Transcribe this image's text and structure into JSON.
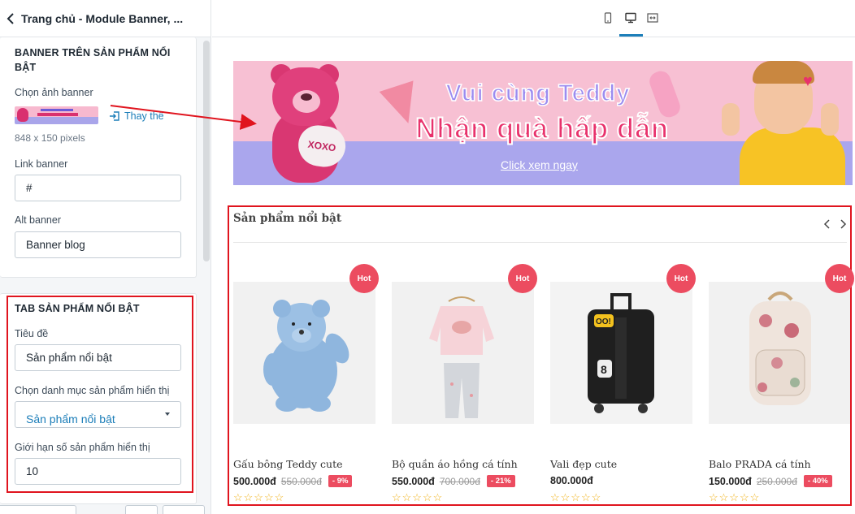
{
  "header": {
    "title": "Trang chủ - Module Banner, ..."
  },
  "banner_section": {
    "title": "BANNER TRÊN SẢN PHẨM NỔI BẬT",
    "image_label": "Chọn ảnh banner",
    "replace_label": "Thay thế",
    "image_size": "848 x 150 pixels",
    "link_label": "Link banner",
    "link_value": "#",
    "alt_label": "Alt banner",
    "alt_value": "Banner blog"
  },
  "tab_section": {
    "title": "TAB SẢN PHẨM NỔI BẬT",
    "title_label": "Tiêu đề",
    "title_value": "Sản phẩm nổi bật",
    "category_label": "Chọn danh mục sản phẩm hiển thị",
    "category_value": "Sản phẩm nổi bật",
    "limit_label": "Giới hạn số sản phẩm hiển thị",
    "limit_value": "10"
  },
  "toolbar": {
    "devices": [
      "mobile-icon",
      "desktop-icon",
      "fullwidth-icon"
    ],
    "active_device": "desktop"
  },
  "preview": {
    "banner": {
      "line1": "Vui cùng Teddy",
      "line2": "Nhận quà hấp dẫn",
      "cta": "Click xem ngay",
      "bear_text": "XOXO"
    },
    "section_title": "Sản phẩm nổi bật",
    "products": [
      {
        "name": "Gấu bông Teddy cute",
        "price": "500.000đ",
        "old_price": "550.000đ",
        "discount": "- 9%",
        "badge": "Hot",
        "stars": "☆☆☆☆☆"
      },
      {
        "name": "Bộ quần áo hồng cá tính",
        "price": "550.000đ",
        "old_price": "700.000đ",
        "discount": "- 21%",
        "badge": "Hot",
        "stars": "☆☆☆☆☆"
      },
      {
        "name": "Vali đẹp cute",
        "price": "800.000đ",
        "old_price": "",
        "discount": "",
        "badge": "Hot",
        "stars": "☆☆☆☆☆"
      },
      {
        "name": "Balo PRADA cá tính",
        "price": "150.000đ",
        "old_price": "250.000đ",
        "discount": "- 40%",
        "badge": "Hot",
        "stars": "☆☆☆☆☆"
      }
    ]
  },
  "colors": {
    "accent": "#1c7eb9",
    "highlight": "#e0141e",
    "hot": "#ec4c60"
  }
}
